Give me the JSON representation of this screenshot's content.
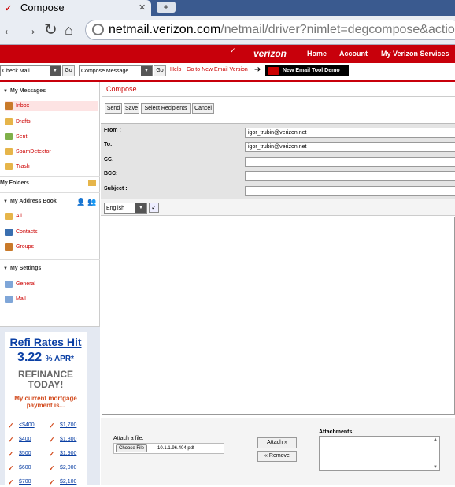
{
  "browser": {
    "tab_title": "Compose",
    "url_host": "netmail.verizon.com",
    "url_path": "/netmail/driver?nimlet=degcompose&action="
  },
  "header": {
    "brand": "verizon",
    "nav": [
      "Home",
      "Account",
      "My Verizon Services"
    ]
  },
  "toolbar": {
    "check_mail": "Check Mail",
    "go1": "Go",
    "compose_select": "Compose Message",
    "go2": "Go",
    "help": "Help",
    "legacy_link": "Go to New Email Version",
    "demo": "New Email Tool Demo"
  },
  "sidebar": {
    "my_messages": "My Messages",
    "messages": [
      "Inbox",
      "Drafts",
      "Sent",
      "SpamDetector",
      "Trash"
    ],
    "my_folders": "My Folders",
    "address_book": "My Address Book",
    "address_items": [
      "All",
      "Contacts",
      "Groups"
    ],
    "settings": "My Settings",
    "settings_items": [
      "General",
      "Mail"
    ]
  },
  "ad": {
    "title": "Refi Rates Hit",
    "rate": "3.22",
    "rate_suffix": "% APR*",
    "refinance": "REFINANCE",
    "today": "TODAY!",
    "payment": "My current mortgage payment is...",
    "amounts": [
      "<$400",
      "$1,700",
      "$400",
      "$1,800",
      "$500",
      "$1,900",
      "$600",
      "$2,000",
      "$700",
      "$2,100"
    ]
  },
  "compose": {
    "title": "Compose",
    "buttons": [
      "Send",
      "Save",
      "Select Recipients",
      "Cancel"
    ],
    "labels": {
      "from": "From :",
      "to": "To:",
      "cc": "CC:",
      "bcc": "BCC:",
      "subject": "Subject :"
    },
    "values": {
      "from": "igor_trubin@verizon.net",
      "to": "igor_trubin@verizon.net",
      "cc": "",
      "bcc": "",
      "subject": ""
    },
    "language": "English",
    "attach_label": "Attach a file:",
    "choose_file": "Choose File",
    "file_name": "10.1.1.96.404.pdf",
    "attach_btn": "Attach »",
    "remove_btn": "« Remove",
    "attachments_label": "Attachments:"
  },
  "colors": {
    "brand_red": "#c8000b",
    "link_red": "#cc0000",
    "ad_blue": "#0a3fa4"
  }
}
